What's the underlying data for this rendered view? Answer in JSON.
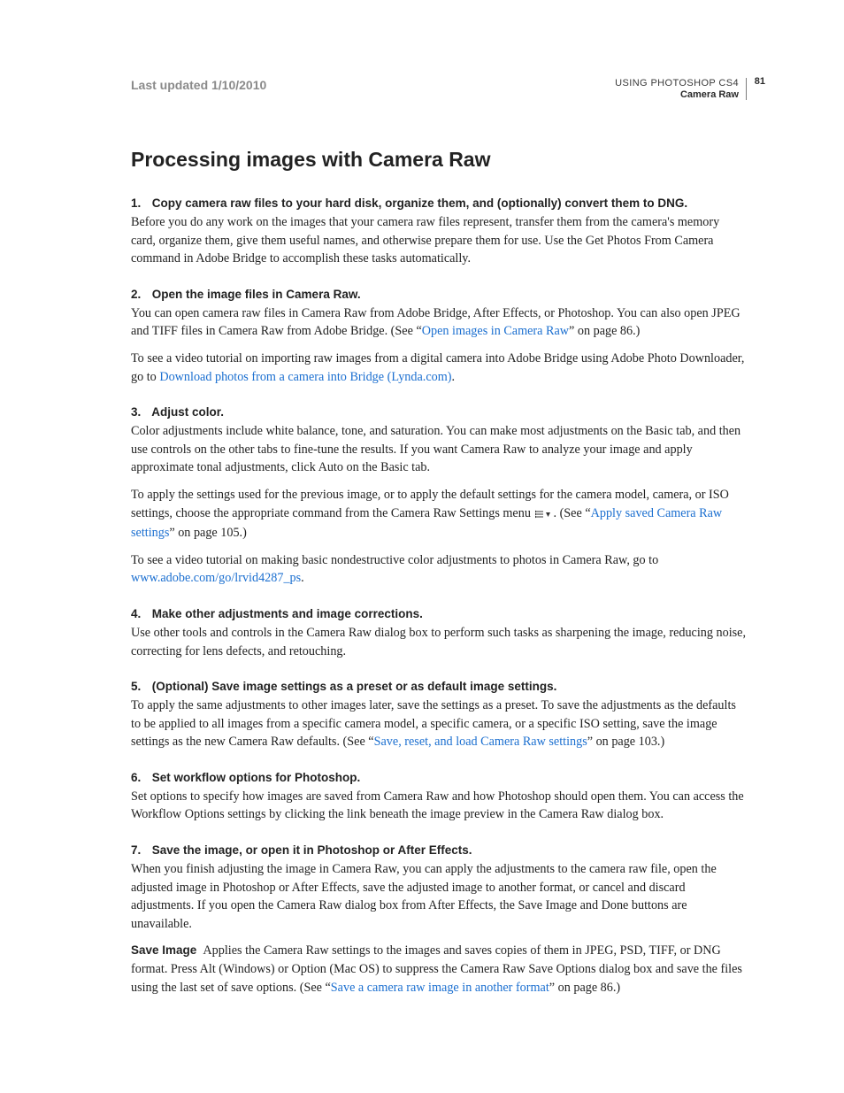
{
  "header": {
    "updated": "Last updated 1/10/2010",
    "doc_title": "USING PHOTOSHOP CS4",
    "section": "Camera Raw",
    "page": "81"
  },
  "title": "Processing images with Camera Raw",
  "steps": {
    "s1": {
      "num": "1.",
      "title": "Copy camera raw files to your hard disk, organize them, and (optionally) convert them to DNG.",
      "p1": "Before you do any work on the images that your camera raw files represent, transfer them from the camera's memory card, organize them, give them useful names, and otherwise prepare them for use. Use the Get Photos From Camera command in Adobe Bridge to accomplish these tasks automatically."
    },
    "s2": {
      "num": "2.",
      "title": "Open the image files in Camera Raw.",
      "p1a": "You can open camera raw files in Camera Raw from Adobe Bridge, After Effects, or Photoshop. You can also open JPEG and TIFF files in Camera Raw from Adobe Bridge. (See “",
      "link1": "Open images in Camera Raw",
      "p1b": "” on page 86.)",
      "p2a": "To see a video tutorial on importing raw images from a digital camera into Adobe Bridge using Adobe Photo Downloader, go to ",
      "link2": "Download photos from a camera into Bridge (Lynda.com)",
      "p2b": "."
    },
    "s3": {
      "num": "3.",
      "title": "Adjust color.",
      "p1": "Color adjustments include white balance, tone, and saturation. You can make most adjustments on the Basic tab, and then use controls on the other tabs to fine-tune the results. If you want Camera Raw to analyze your image and apply approximate tonal adjustments, click Auto on the Basic tab.",
      "p2a": "To apply the settings used for the previous image, or to apply the default settings for the camera model, camera, or ISO settings, choose the appropriate command from the Camera Raw Settings menu ",
      "p2b": ". (See “",
      "link1": "Apply saved Camera Raw settings",
      "p2c": "” on page 105.)",
      "p3a": "To see a video tutorial on making basic nondestructive color adjustments to photos in Camera Raw, go to ",
      "link2": "www.adobe.com/go/lrvid4287_ps",
      "p3b": "."
    },
    "s4": {
      "num": "4.",
      "title": "Make other adjustments and image corrections.",
      "p1": "Use other tools and controls in the Camera Raw dialog box to perform such tasks as sharpening the image, reducing noise, correcting for lens defects, and retouching."
    },
    "s5": {
      "num": "5.",
      "title": "(Optional) Save image settings as a preset or as default image settings.",
      "p1a": "To apply the same adjustments to other images later, save the settings as a preset. To save the adjustments as the defaults to be applied to all images from a specific camera model, a specific camera, or a specific ISO setting, save the image settings as the new Camera Raw defaults. (See “",
      "link1": "Save, reset, and load Camera Raw settings",
      "p1b": "” on page 103.)"
    },
    "s6": {
      "num": "6.",
      "title": "Set workflow options for Photoshop.",
      "p1": "Set options to specify how images are saved from Camera Raw and how Photoshop should open them. You can access the Workflow Options settings by clicking the link beneath the image preview in the Camera Raw dialog box."
    },
    "s7": {
      "num": "7.",
      "title": "Save the image, or open it in Photoshop or After Effects.",
      "p1": "When you finish adjusting the image in Camera Raw, you can apply the adjustments to the camera raw file, open the adjusted image in Photoshop or After Effects, save the adjusted image to another format, or cancel and discard adjustments. If you open the Camera Raw dialog box from After Effects, the Save Image and Done buttons are unavailable.",
      "runin": "Save Image",
      "p2a": "Applies the Camera Raw settings to the images and saves copies of them in JPEG, PSD, TIFF, or DNG format. Press Alt (Windows) or Option (Mac OS) to suppress the Camera Raw Save Options dialog box and save the files using the last set of save options. (See “",
      "link1": "Save a camera raw image in another format",
      "p2b": "” on page 86.)"
    }
  }
}
